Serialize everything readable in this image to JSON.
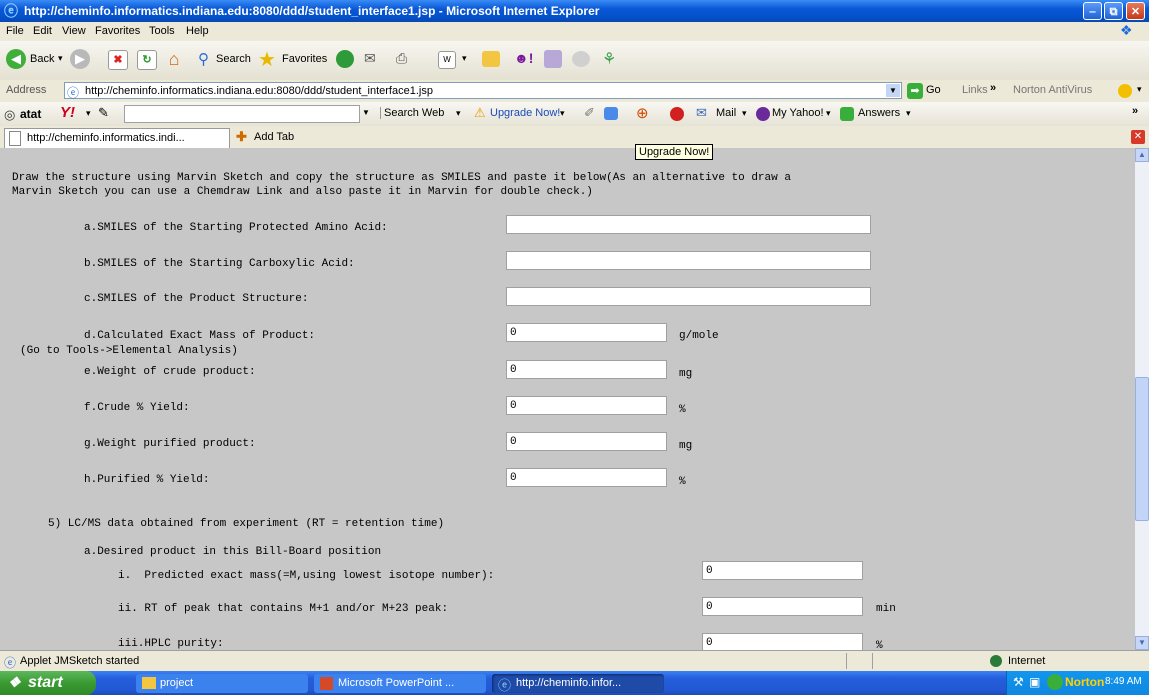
{
  "window": {
    "title": "http://cheminfo.informatics.indiana.edu:8080/ddd/student_interface1.jsp - Microsoft Internet Explorer"
  },
  "menu": [
    "File",
    "Edit",
    "View",
    "Favorites",
    "Tools",
    "Help"
  ],
  "toolbar": {
    "back": "Back",
    "search": "Search",
    "favorites": "Favorites"
  },
  "address": {
    "label": "Address",
    "url": "http://cheminfo.informatics.indiana.edu:8080/ddd/student_interface1.jsp",
    "go": "Go",
    "links": "Links",
    "norton": "Norton AntiVirus"
  },
  "yahoo": {
    "brand": "atat",
    "search_web": "Search Web",
    "upgrade": "Upgrade Now!",
    "mail": "Mail",
    "my_yahoo": "My Yahoo!",
    "answers": "Answers"
  },
  "tabs": {
    "active": "http://cheminfo.informatics.indi...",
    "add": "Add Tab",
    "tooltip": "Upgrade Now!"
  },
  "page": {
    "intro_line1": "Draw the structure using Marvin Sketch and copy the structure as SMILES and paste it below(As an alternative to draw a",
    "intro_line2": "Marvin Sketch you can use a Chemdraw Link and also paste it in Marvin for double check.)",
    "fields": {
      "a_label": "a.SMILES of the Starting Protected Amino Acid:",
      "a_value": "",
      "b_label": "b.SMILES of the Starting Carboxylic Acid:",
      "b_value": "",
      "c_label": "c.SMILES of the Product Structure:",
      "c_value": "",
      "d_label": "d.Calculated Exact Mass of Product:",
      "d_value": "0",
      "d_unit": "g/mole",
      "d_note": "(Go to Tools->Elemental Analysis)",
      "e_label": "e.Weight of crude product:",
      "e_value": "0",
      "e_unit": "mg",
      "f_label": "f.Crude % Yield:",
      "f_value": "0",
      "f_unit": "%",
      "g_label": "g.Weight purified product:",
      "g_value": "0",
      "g_unit": "mg",
      "h_label": "h.Purified % Yield:",
      "h_value": "0",
      "h_unit": "%"
    },
    "section5": "5) LC/MS data obtained from experiment (RT = retention time)",
    "sub_a": "a.Desired product in this Bill-Board position",
    "lcms": {
      "i_label": "i.  Predicted exact mass(=M,using lowest isotope number):",
      "i_value": "0",
      "ii_label": "ii. RT of peak that contains M+1 and/or M+23 peak:",
      "ii_value": "0",
      "ii_unit": "min",
      "iii_label": "iii.HPLC purity:",
      "iii_value": "0",
      "iii_unit": "%"
    }
  },
  "status": {
    "text": "Applet JMSketch started",
    "zone": "Internet"
  },
  "taskbar": {
    "start": "start",
    "items": [
      "project",
      "Microsoft PowerPoint ...",
      "http://cheminfo.infor..."
    ],
    "norton": "Norton",
    "time": "8:49 AM"
  },
  "colors": {
    "title_bar": "#0a58d8",
    "content_bg": "#c7c7c7",
    "taskbar": "#245edb",
    "start_green": "#3a9a32"
  }
}
